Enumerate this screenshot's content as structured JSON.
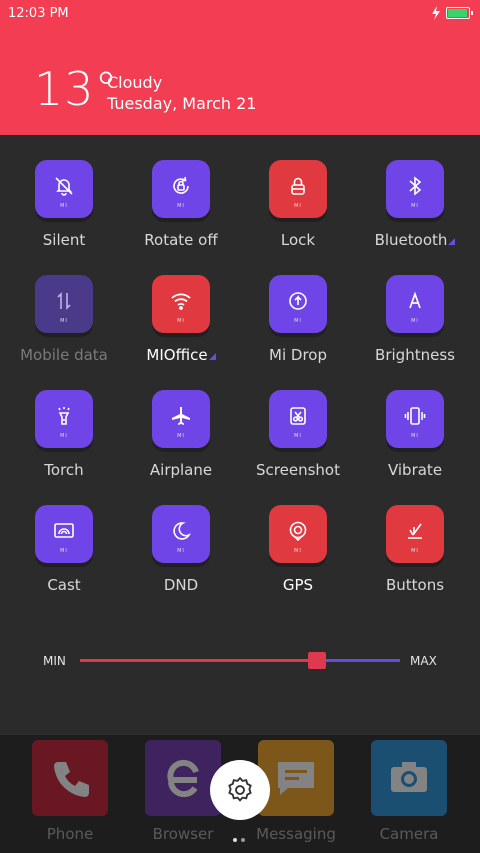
{
  "status_bar": {
    "time": "12:03 PM"
  },
  "weather": {
    "temperature": "13°",
    "condition": "Cloudy",
    "date": "Tuesday, March 21"
  },
  "toggles": [
    {
      "label": "Silent",
      "icon": "bell-off-icon",
      "state": "on"
    },
    {
      "label": "Rotate off",
      "icon": "rotate-lock-icon",
      "state": "on"
    },
    {
      "label": "Lock",
      "icon": "lock-icon",
      "state": "off"
    },
    {
      "label": "Bluetooth",
      "icon": "bluetooth-icon",
      "state": "on"
    },
    {
      "label": "Mobile data",
      "icon": "mobile-data-icon",
      "state": "disabled"
    },
    {
      "label": "MIOffice",
      "icon": "wifi-icon",
      "state": "off"
    },
    {
      "label": "Mi Drop",
      "icon": "mi-drop-icon",
      "state": "on"
    },
    {
      "label": "Brightness",
      "icon": "brightness-auto-icon",
      "state": "on"
    },
    {
      "label": "Torch",
      "icon": "torch-icon",
      "state": "on"
    },
    {
      "label": "Airplane",
      "icon": "airplane-icon",
      "state": "on"
    },
    {
      "label": "Screenshot",
      "icon": "screenshot-icon",
      "state": "on"
    },
    {
      "label": "Vibrate",
      "icon": "vibrate-icon",
      "state": "on"
    },
    {
      "label": "Cast",
      "icon": "cast-icon",
      "state": "on"
    },
    {
      "label": "DND",
      "icon": "moon-icon",
      "state": "on"
    },
    {
      "label": "GPS",
      "icon": "gps-icon",
      "state": "off"
    },
    {
      "label": "Buttons",
      "icon": "buttons-icon",
      "state": "off"
    }
  ],
  "brightness": {
    "min_label": "MIN",
    "max_label": "MAX",
    "level": 0.74
  },
  "dock": [
    {
      "label": "Phone",
      "icon": "phone-icon"
    },
    {
      "label": "Browser",
      "icon": "browser-icon"
    },
    {
      "label": "Messaging",
      "icon": "messaging-icon"
    },
    {
      "label": "Camera",
      "icon": "camera-icon"
    }
  ],
  "colors": {
    "accent_red": "#f23d52",
    "tile_purple": "#6f45e8",
    "tile_red": "#e0393f"
  }
}
